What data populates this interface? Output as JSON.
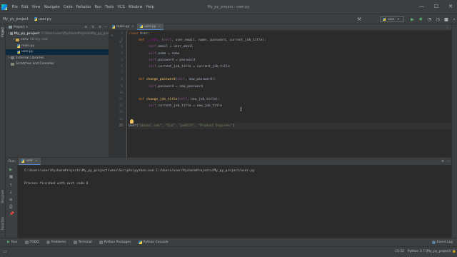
{
  "window": {
    "title": "My_py_project - user.py"
  },
  "menu": [
    "File",
    "Edit",
    "View",
    "Navigate",
    "Code",
    "Refactor",
    "Run",
    "Tools",
    "VCS",
    "Window",
    "Help"
  ],
  "breadcrumbs": [
    "My_py_project",
    "user.py"
  ],
  "run_config": "user",
  "project_panel": {
    "title": "Project",
    "tree": [
      {
        "label": "My_py_project",
        "path": "C:\\Users\\user\\PycharmProjects\\My_py_pro",
        "kind": "folder",
        "toggle": "v"
      },
      {
        "label": "venv",
        "path": "library root",
        "kind": "folder",
        "toggle": ">"
      },
      {
        "label": "main.py",
        "path": "",
        "kind": "py",
        "toggle": ""
      },
      {
        "label": "user.py",
        "path": "",
        "kind": "py",
        "toggle": ""
      },
      {
        "label": "External Libraries",
        "path": "",
        "kind": "lib",
        "toggle": ">"
      },
      {
        "label": "Scratches and Consoles",
        "path": "",
        "kind": "lib",
        "toggle": ""
      }
    ]
  },
  "editor_tabs": [
    {
      "label": "main.py",
      "active": false
    },
    {
      "label": "user.py",
      "active": true
    }
  ],
  "editor": {
    "line_numbers": [
      "1",
      "2",
      "3",
      "4",
      "5",
      "6",
      "7",
      "8",
      "9",
      "10",
      "11",
      "12",
      "13",
      "14",
      "15"
    ],
    "current_line": "15",
    "lines": {
      "l1_kw": "class ",
      "l1_name": "User:",
      "l2_kw": "def ",
      "l2_fn": "__init__",
      "l2_open": "(",
      "l2_self": "self",
      "l2_params": ", user_email, name, password, current_job_title):",
      "l3_self": "self",
      "l3_rest": ".email = user_email",
      "l4_self": "self",
      "l4_rest": ".name = name",
      "l5_self": "self",
      "l5_rest": ".password = password",
      "l6_self": "self",
      "l6_rest": ".current_job_title = current_job_title",
      "l8_kw": "def ",
      "l8_fn": "change_password",
      "l8_open": "(",
      "l8_self": "self",
      "l8_params": ", new_password):",
      "l9_self": "self",
      "l9_rest": ".password = new_password",
      "l11_kw": "def ",
      "l11_fn": "change_job_title",
      "l11_open": "(",
      "l11_self": "self",
      "l11_params": ", new_job_title):",
      "l12_self": "self",
      "l12_rest": ".current_job_title = new_job_title",
      "l15_call": "User(",
      "l15_args": "\"abc@xl.com\", \"Sid\", \"pwd123\", \"Product Engineer\"",
      "l15_close": ")"
    }
  },
  "run_panel": {
    "label": "Run:",
    "tab": "user",
    "console": [
      "C:\\Users\\user\\PycharmProjects\\My_py_project\\venv\\Scripts\\python.exe C:/Users/user/PycharmProjects/My_py_project/user.py",
      "",
      "Process finished with exit code 0"
    ]
  },
  "bottom_tools": [
    "Run",
    "TODO",
    "Problems",
    "Terminal",
    "Python Packages",
    "Python Console"
  ],
  "event_log": "Event Log",
  "status": {
    "position": "15:32",
    "interpreter": "Python 3.7 (My_py_project)"
  },
  "colors": {
    "accent": "#4a88c7",
    "run_green": "#59a869",
    "keyword": "#cc7832",
    "function": "#ffc66d",
    "self": "#94558d",
    "string": "#6a8759"
  }
}
